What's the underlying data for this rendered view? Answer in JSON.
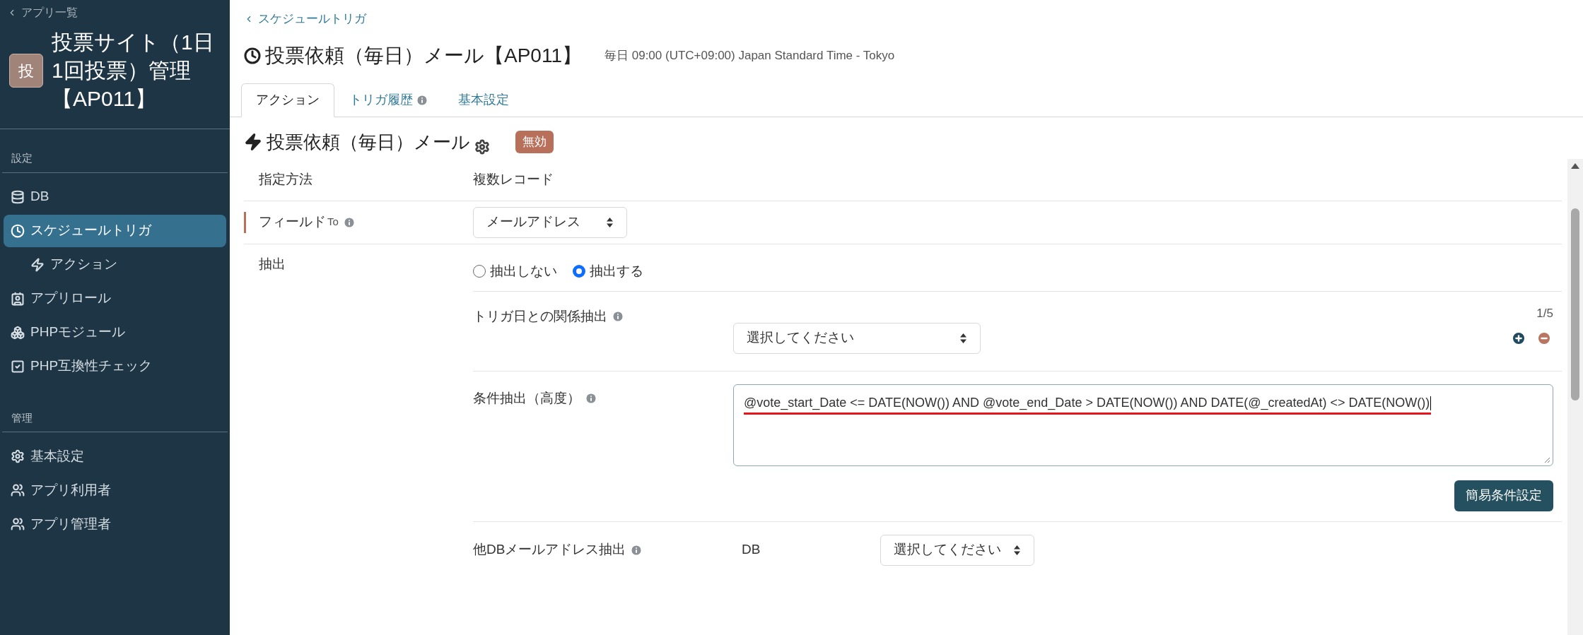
{
  "sidebar": {
    "back_link": "アプリ一覧",
    "app_icon_text": "投",
    "app_title": "投票サイト（1日1回投票）管理【AP011】",
    "sections": [
      {
        "heading": "設定",
        "items": [
          {
            "label": "DB",
            "kind": "database",
            "selected": false
          },
          {
            "label": "スケジュールトリガ",
            "kind": "clock",
            "selected": true,
            "children": [
              {
                "label": "アクション",
                "kind": "bolt",
                "selected": false
              }
            ]
          },
          {
            "label": "アプリロール",
            "kind": "badge",
            "selected": false
          },
          {
            "label": "PHPモジュール",
            "kind": "cubes",
            "selected": false
          },
          {
            "label": "PHP互換性チェック",
            "kind": "check",
            "selected": false
          }
        ]
      },
      {
        "heading": "管理",
        "items": [
          {
            "label": "基本設定",
            "kind": "gear",
            "selected": false
          },
          {
            "label": "アプリ利用者",
            "kind": "users",
            "selected": false
          },
          {
            "label": "アプリ管理者",
            "kind": "users",
            "selected": false
          }
        ]
      }
    ]
  },
  "main": {
    "back_link": "スケジュールトリガ",
    "title": "投票依頼（毎日）メール【AP011】",
    "schedule": "毎日 09:00 (UTC+09:00) Japan Standard Time - Tokyo",
    "tabs": [
      {
        "label": "アクション",
        "selected": true,
        "info": false
      },
      {
        "label": "トリガ履歴",
        "selected": false,
        "info": true
      },
      {
        "label": "基本設定",
        "selected": false,
        "info": false
      }
    ],
    "action": {
      "title": "投票依頼（毎日）メール",
      "badge": "無効"
    },
    "rows": [
      {
        "kind": "text",
        "label": "指定方法",
        "marked": false,
        "info": false,
        "value": "複数レコード"
      },
      {
        "kind": "select",
        "label": "フィールド",
        "label_suffix": "To",
        "marked": true,
        "info": true,
        "value": "メールアドレス"
      },
      {
        "kind": "extract",
        "label": "抽出",
        "marked": false,
        "info": false,
        "options": [
          {
            "label": "抽出しない",
            "selected": false
          },
          {
            "label": "抽出する",
            "selected": true
          }
        ],
        "subrows": [
          {
            "kind": "relation",
            "label": "トリガ日との関係抽出",
            "info": true,
            "counter": "1/5",
            "select": "選択してください"
          },
          {
            "kind": "condition",
            "label": "条件抽出（高度）",
            "info": true,
            "value": "@vote_start_Date <= DATE(NOW()) AND @vote_end_Date > DATE(NOW()) AND DATE(@_createdAt) <> DATE(NOW())",
            "underlined": true,
            "button": "簡易条件設定"
          },
          {
            "kind": "db",
            "label": "他DBメールアドレス抽出",
            "info": true,
            "field_label": "DB",
            "select": "選択してください"
          }
        ]
      }
    ]
  }
}
